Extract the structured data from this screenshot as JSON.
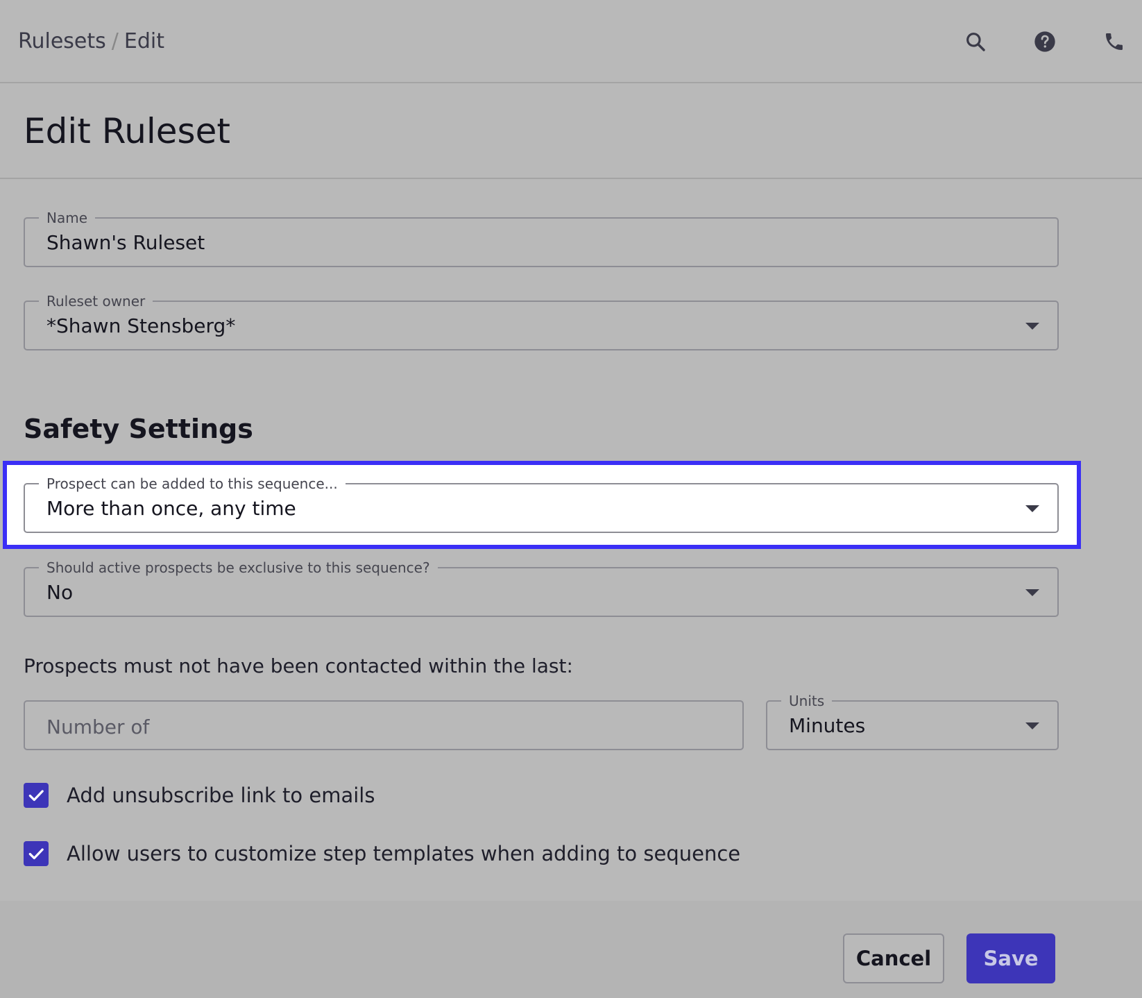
{
  "breadcrumb": {
    "parent": "Rulesets",
    "separator": "/",
    "current": "Edit"
  },
  "toolbar": {
    "icons": [
      "search-icon",
      "help-icon",
      "phone-icon"
    ]
  },
  "page": {
    "title": "Edit Ruleset"
  },
  "form": {
    "name": {
      "label": "Name",
      "value": "Shawn's Ruleset"
    },
    "owner": {
      "label": "Ruleset owner",
      "value": "*Shawn Stensberg*"
    }
  },
  "safety": {
    "title": "Safety Settings",
    "prospect_added": {
      "label": "Prospect can be added to this sequence...",
      "value": "More than once, any time"
    },
    "exclusive": {
      "label": "Should active prospects be exclusive to this sequence?",
      "value": "No"
    },
    "contacted_text": "Prospects must not have been contacted within the last:",
    "number": {
      "placeholder": "Number of"
    },
    "units": {
      "label": "Units",
      "value": "Minutes"
    },
    "checkboxes": [
      {
        "label": "Add unsubscribe link to emails",
        "checked": true
      },
      {
        "label": "Allow users to customize step templates when adding to sequence",
        "checked": true
      }
    ]
  },
  "actions": {
    "cancel_label": "Cancel",
    "save_label": "Save"
  },
  "colors": {
    "accent": "#3d35b8",
    "highlight": "#3b2ff6",
    "background": "#b9b9b9"
  }
}
